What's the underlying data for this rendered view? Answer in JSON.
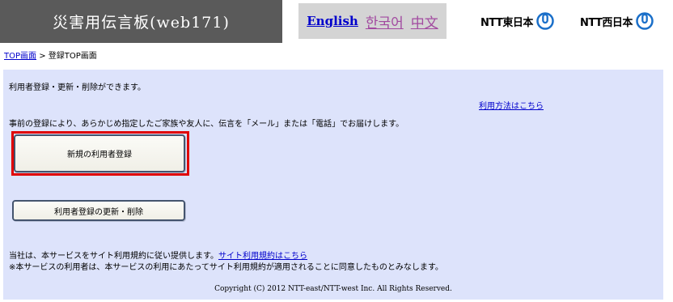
{
  "header": {
    "title": "災害用伝言板(web171)",
    "languages": {
      "english": "English",
      "korean": "한국어",
      "chinese": "中文"
    },
    "logos": {
      "east": "NTT東日本",
      "west": "NTT西日本",
      "logo_color": "#1a6fc9"
    }
  },
  "breadcrumb": {
    "home": "TOP画面",
    "separator": ">",
    "current": "登録TOP画面"
  },
  "main": {
    "intro": "利用者登録・更新・削除ができます。",
    "help_link": "利用方法はこちら",
    "description": "事前の登録により、あらかじめ指定したご家族や友人に、伝言を「メール」または「電話」でお届けします。",
    "new_button": "新規の利用者登録",
    "update_button": "利用者登録の更新・削除",
    "terms_text": "当社は、本サービスをサイト利用規約に従い提供します。",
    "terms_link": "サイト利用規約はこちら",
    "consent_text": "※本サービスの利用者は、本サービスの利用にあたってサイト利用規約が適用されることに同意したものとみなします。",
    "copyright": "Copyright (C) 2012 NTT-east/NTT-west Inc. All Rights Reserved."
  },
  "colors": {
    "title_bg": "#5a5a5a",
    "panel_bg": "#dde3fb",
    "link": "#0000cc",
    "highlight_frame": "#e00000"
  }
}
